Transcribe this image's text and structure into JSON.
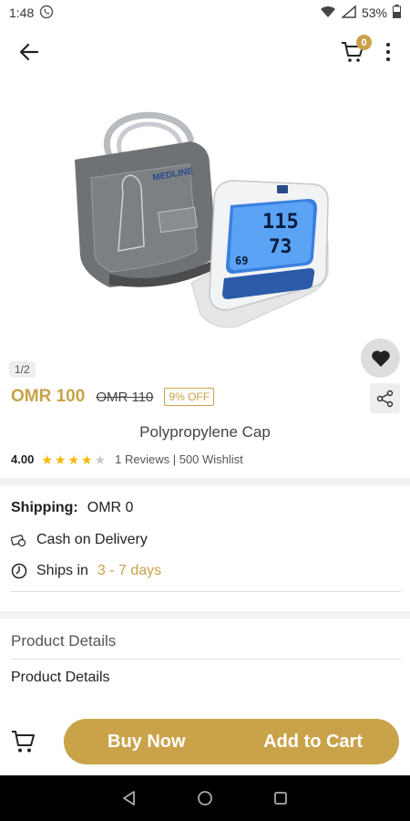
{
  "status_bar": {
    "time": "1:48",
    "battery": "53%"
  },
  "header": {
    "cart_count": "0"
  },
  "product": {
    "image_counter": "1/2",
    "price": "OMR 100",
    "old_price": "OMR 110",
    "discount": "9% OFF",
    "name": "Polypropylene Cap",
    "rating": "4.00",
    "stars_filled": 4,
    "stars_total": 5,
    "reviews_summary": "1 Reviews | 500 Wishlist",
    "monitor_reading_top": "115",
    "monitor_reading_mid": "73",
    "monitor_reading_low": "69"
  },
  "shipping": {
    "label": "Shipping:",
    "value": "OMR 0",
    "cod": "Cash on Delivery",
    "ships_in_label": "Ships in",
    "ships_in_days": "3 - 7 days"
  },
  "details": {
    "header": "Product Details",
    "body": "Product Details"
  },
  "actions": {
    "buy_now": "Buy Now",
    "add_to_cart": "Add to Cart"
  },
  "colors": {
    "accent": "#c9a24a",
    "star_empty": "#c8c8c8",
    "star_filled": "#f5b800"
  }
}
